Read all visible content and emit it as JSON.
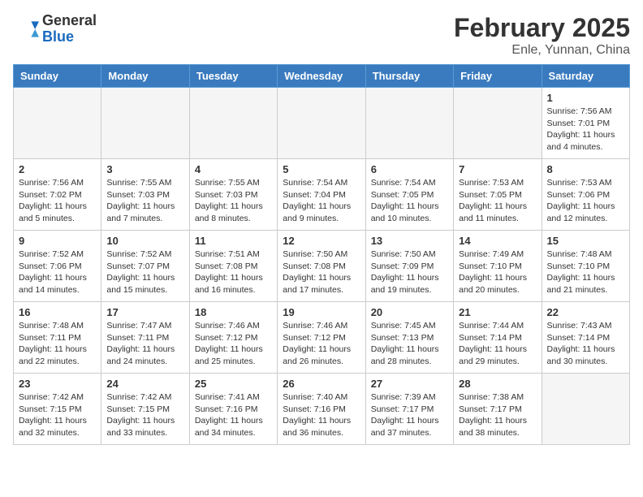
{
  "header": {
    "logo_general": "General",
    "logo_blue": "Blue",
    "month_year": "February 2025",
    "location": "Enle, Yunnan, China"
  },
  "weekdays": [
    "Sunday",
    "Monday",
    "Tuesday",
    "Wednesday",
    "Thursday",
    "Friday",
    "Saturday"
  ],
  "weeks": [
    [
      {
        "day": "",
        "info": ""
      },
      {
        "day": "",
        "info": ""
      },
      {
        "day": "",
        "info": ""
      },
      {
        "day": "",
        "info": ""
      },
      {
        "day": "",
        "info": ""
      },
      {
        "day": "",
        "info": ""
      },
      {
        "day": "1",
        "info": "Sunrise: 7:56 AM\nSunset: 7:01 PM\nDaylight: 11 hours\nand 4 minutes."
      }
    ],
    [
      {
        "day": "2",
        "info": "Sunrise: 7:56 AM\nSunset: 7:02 PM\nDaylight: 11 hours\nand 5 minutes."
      },
      {
        "day": "3",
        "info": "Sunrise: 7:55 AM\nSunset: 7:03 PM\nDaylight: 11 hours\nand 7 minutes."
      },
      {
        "day": "4",
        "info": "Sunrise: 7:55 AM\nSunset: 7:03 PM\nDaylight: 11 hours\nand 8 minutes."
      },
      {
        "day": "5",
        "info": "Sunrise: 7:54 AM\nSunset: 7:04 PM\nDaylight: 11 hours\nand 9 minutes."
      },
      {
        "day": "6",
        "info": "Sunrise: 7:54 AM\nSunset: 7:05 PM\nDaylight: 11 hours\nand 10 minutes."
      },
      {
        "day": "7",
        "info": "Sunrise: 7:53 AM\nSunset: 7:05 PM\nDaylight: 11 hours\nand 11 minutes."
      },
      {
        "day": "8",
        "info": "Sunrise: 7:53 AM\nSunset: 7:06 PM\nDaylight: 11 hours\nand 12 minutes."
      }
    ],
    [
      {
        "day": "9",
        "info": "Sunrise: 7:52 AM\nSunset: 7:06 PM\nDaylight: 11 hours\nand 14 minutes."
      },
      {
        "day": "10",
        "info": "Sunrise: 7:52 AM\nSunset: 7:07 PM\nDaylight: 11 hours\nand 15 minutes."
      },
      {
        "day": "11",
        "info": "Sunrise: 7:51 AM\nSunset: 7:08 PM\nDaylight: 11 hours\nand 16 minutes."
      },
      {
        "day": "12",
        "info": "Sunrise: 7:50 AM\nSunset: 7:08 PM\nDaylight: 11 hours\nand 17 minutes."
      },
      {
        "day": "13",
        "info": "Sunrise: 7:50 AM\nSunset: 7:09 PM\nDaylight: 11 hours\nand 19 minutes."
      },
      {
        "day": "14",
        "info": "Sunrise: 7:49 AM\nSunset: 7:10 PM\nDaylight: 11 hours\nand 20 minutes."
      },
      {
        "day": "15",
        "info": "Sunrise: 7:48 AM\nSunset: 7:10 PM\nDaylight: 11 hours\nand 21 minutes."
      }
    ],
    [
      {
        "day": "16",
        "info": "Sunrise: 7:48 AM\nSunset: 7:11 PM\nDaylight: 11 hours\nand 22 minutes."
      },
      {
        "day": "17",
        "info": "Sunrise: 7:47 AM\nSunset: 7:11 PM\nDaylight: 11 hours\nand 24 minutes."
      },
      {
        "day": "18",
        "info": "Sunrise: 7:46 AM\nSunset: 7:12 PM\nDaylight: 11 hours\nand 25 minutes."
      },
      {
        "day": "19",
        "info": "Sunrise: 7:46 AM\nSunset: 7:12 PM\nDaylight: 11 hours\nand 26 minutes."
      },
      {
        "day": "20",
        "info": "Sunrise: 7:45 AM\nSunset: 7:13 PM\nDaylight: 11 hours\nand 28 minutes."
      },
      {
        "day": "21",
        "info": "Sunrise: 7:44 AM\nSunset: 7:14 PM\nDaylight: 11 hours\nand 29 minutes."
      },
      {
        "day": "22",
        "info": "Sunrise: 7:43 AM\nSunset: 7:14 PM\nDaylight: 11 hours\nand 30 minutes."
      }
    ],
    [
      {
        "day": "23",
        "info": "Sunrise: 7:42 AM\nSunset: 7:15 PM\nDaylight: 11 hours\nand 32 minutes."
      },
      {
        "day": "24",
        "info": "Sunrise: 7:42 AM\nSunset: 7:15 PM\nDaylight: 11 hours\nand 33 minutes."
      },
      {
        "day": "25",
        "info": "Sunrise: 7:41 AM\nSunset: 7:16 PM\nDaylight: 11 hours\nand 34 minutes."
      },
      {
        "day": "26",
        "info": "Sunrise: 7:40 AM\nSunset: 7:16 PM\nDaylight: 11 hours\nand 36 minutes."
      },
      {
        "day": "27",
        "info": "Sunrise: 7:39 AM\nSunset: 7:17 PM\nDaylight: 11 hours\nand 37 minutes."
      },
      {
        "day": "28",
        "info": "Sunrise: 7:38 AM\nSunset: 7:17 PM\nDaylight: 11 hours\nand 38 minutes."
      },
      {
        "day": "",
        "info": ""
      }
    ]
  ]
}
